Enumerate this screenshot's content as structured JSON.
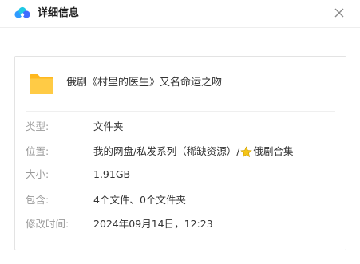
{
  "header": {
    "title": "详细信息",
    "logo_icon": "baidu-netdisk-cloud-icon",
    "close_icon": "close-icon"
  },
  "file": {
    "name": "俄剧《村里的医生》又名命运之吻",
    "icon": "folder-icon",
    "folder_color": "#FFC93A"
  },
  "details": {
    "type_label": "类型:",
    "type_value": "文件夹",
    "location_label": "位置:",
    "location_path": "我的网盘/私发系列（稀缺资源）/",
    "location_star_icon": "star-icon",
    "location_last": "俄剧合集",
    "size_label": "大小:",
    "size_value": "1.91GB",
    "contains_label": "包含:",
    "contains_value": "4个文件、0个文件夹",
    "modified_label": "修改时间:",
    "modified_value": "2024年09月14日，12:23"
  },
  "colors": {
    "label_gray": "#9A9A9A",
    "text_dark": "#333333",
    "star_yellow": "#F5C518"
  }
}
